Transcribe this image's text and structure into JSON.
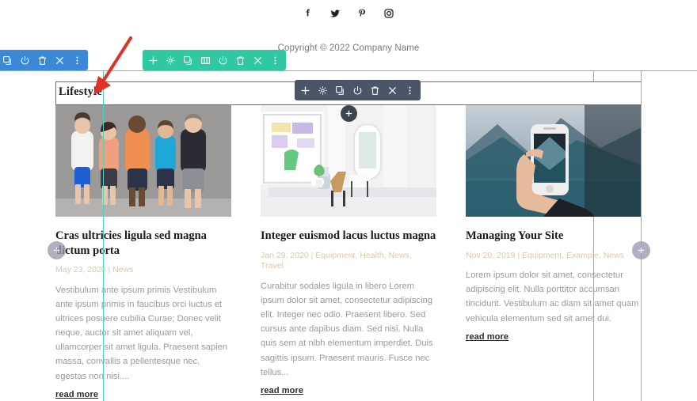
{
  "page": {
    "builder": "visual-page-builder",
    "accent_green": "#2fc8a0",
    "accent_blue": "#3b88d6",
    "accent_dark": "#4a5568",
    "outline_cyan": "#4fd0c0",
    "meta_color": "#dcc9a8",
    "annotation_arrow_color": "#e03127"
  },
  "social": {
    "items": [
      {
        "name": "facebook-icon",
        "label": "Facebook"
      },
      {
        "name": "twitter-icon",
        "label": "Twitter"
      },
      {
        "name": "pinterest-icon",
        "label": "Pinterest"
      },
      {
        "name": "instagram-icon",
        "label": "Instagram"
      }
    ]
  },
  "footer": {
    "copyright": "Copyright © 2022 Company Name"
  },
  "toolbars": {
    "blue": {
      "name": "section-toolbar",
      "icons": [
        "duplicate-icon",
        "power-toggle-icon",
        "trash-icon",
        "close-icon",
        "more-options-icon"
      ]
    },
    "green": {
      "name": "row-toolbar",
      "icons": [
        "plus-icon",
        "gear-icon",
        "duplicate-icon",
        "columns-icon",
        "power-toggle-icon",
        "trash-icon",
        "close-icon",
        "more-options-icon"
      ]
    },
    "dark": {
      "name": "module-toolbar",
      "icons": [
        "plus-icon",
        "gear-icon",
        "duplicate-icon",
        "power-toggle-icon",
        "trash-icon",
        "close-icon",
        "more-options-icon"
      ]
    }
  },
  "section": {
    "title": "Lifestyle"
  },
  "add_buttons": {
    "left_label": "+",
    "right_label": "+",
    "center_label": "+"
  },
  "blog": {
    "posts": [
      {
        "title": "Cras ultricies ligula sed magna dictum porta",
        "date": "May 23, 2020",
        "separator": "|",
        "categories": "News",
        "meta": "May 23, 2020  |  News",
        "excerpt": "Vestibulum ante ipsum primis Vestibulum ante ipsum primis in faucibus orci luctus et ultrices posuere cubilia Curae; Donec velit neque, auctor sit amet aliquam vel, ullamcorper sit amet ligula. Praesent sapien massa, convallis a pellentesque nec, egestas non nisi....",
        "read_more": "read more",
        "image_alt": "group-of-five-people-against-gray-wall"
      },
      {
        "title": "Integer euismod lacus luctus magna",
        "date": "Jan 29, 2020",
        "separator": "|",
        "categories": "Equipment, Health, News, Travel",
        "meta": "Jan 29, 2020  |  Equipment, Health, News, Travel",
        "excerpt": "Curabitur sodales ligula in libero Lorem ipsum dolor sit amet, consectetur adipiscing elit. Integer nec odio. Praesent libero. Sed cursus ante dapibus diam. Sed nisi. Nulla quis sem at nibh elementum imperdiet. Duis sagittis ipsum. Praesent mauris. Fusce nec tellus...",
        "read_more": "read more",
        "image_alt": "bright-white-interior-dining-room"
      },
      {
        "title": "Managing Your Site",
        "date": "Nov 20, 2019",
        "separator": "|",
        "categories": "Equipment, Example, News",
        "meta": "Nov 20, 2019  |  Equipment, Example, News",
        "excerpt": "Lorem ipsum dolor sit amet, consectetur adipiscing elit. Nulla porttitor accumsan tincidunt. Vestibulum ac diam sit amet quam vehicula elementum sed sit amet dui.",
        "read_more": "read more",
        "image_alt": "hand-holding-phone-photographing-mountain-lake"
      }
    ]
  }
}
